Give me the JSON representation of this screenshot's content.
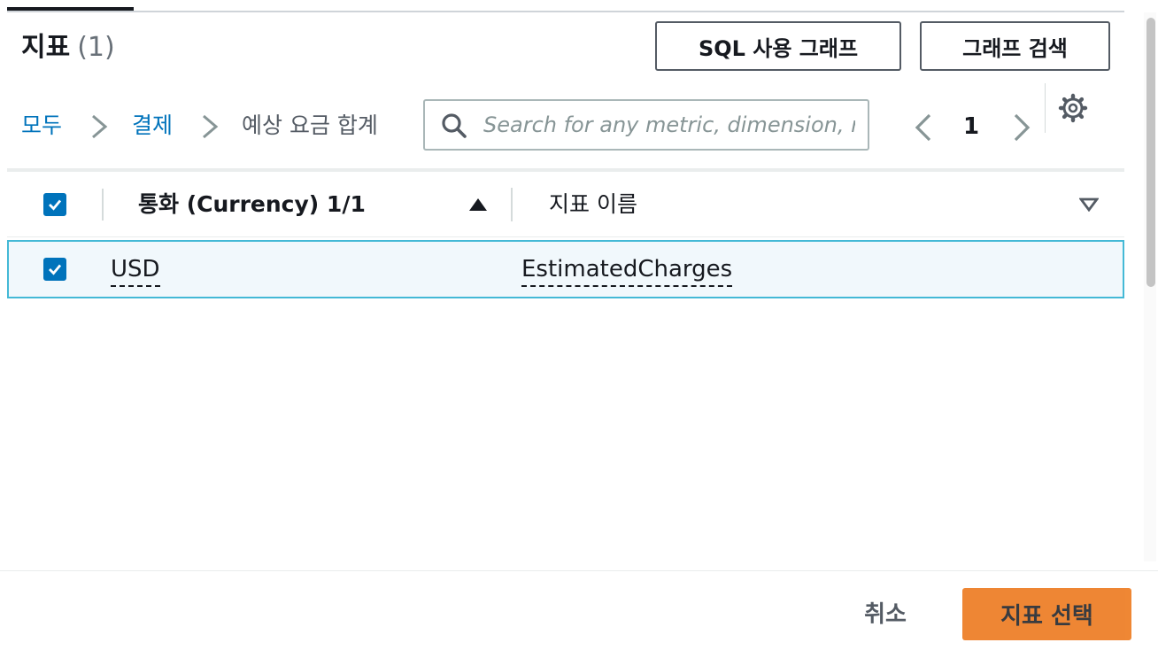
{
  "header": {
    "title": "지표",
    "count": "(1)",
    "sql_button": "SQL 사용 그래프",
    "graph_search_button": "그래프 검색"
  },
  "breadcrumb": {
    "items": [
      {
        "label": "모두"
      },
      {
        "label": "결제"
      },
      {
        "label": "예상 요금 합계"
      }
    ]
  },
  "search": {
    "value": "",
    "placeholder": "Search for any metric, dimension, resource id or account id"
  },
  "pagination": {
    "current_page": "1"
  },
  "table": {
    "columns": [
      {
        "label": "통화 (Currency) 1/1",
        "sort": "ascending"
      },
      {
        "label": "지표 이름",
        "sort": "none"
      }
    ],
    "rows": [
      {
        "selected": true,
        "currency": "USD",
        "metric_name": "EstimatedCharges"
      }
    ]
  },
  "footer": {
    "cancel_label": "취소",
    "confirm_label": "지표 선택"
  },
  "colors": {
    "link": "#0073bb",
    "checkbox": "#0073bb",
    "selected_row_bg": "#f1f8fc",
    "selected_row_border": "#44b9d6",
    "primary_button": "#ec7211"
  }
}
